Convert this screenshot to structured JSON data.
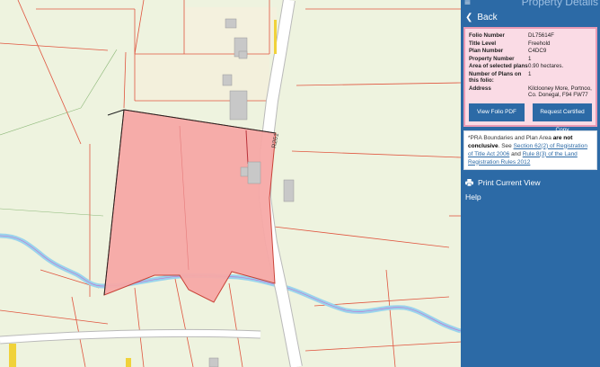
{
  "panel": {
    "title": "Property Details",
    "back_label": "Back",
    "folio": {
      "rows": [
        {
          "label": "Folio Number",
          "value": "DL75614F"
        },
        {
          "label": "Title Level",
          "value": "Freehold"
        },
        {
          "label": "Plan Number",
          "value": "C4DC9"
        },
        {
          "label": "Property Number",
          "value": "1"
        },
        {
          "label": "Area of selected plans",
          "value": "0.90 hectares."
        },
        {
          "label": "Number of Plans on this folio:",
          "value": "1"
        },
        {
          "label": "Address",
          "value": "Kilclooney More, Portnoo, Co. Donegal, F94 FW77"
        }
      ],
      "view_pdf_label": "View Folio PDF",
      "certified_copy_label": "Request Certified Copy"
    },
    "note": {
      "prefix": "*PRA Boundaries and Plan Area ",
      "bold": "are not conclusive",
      "mid1": ". See ",
      "link1": "Section 62(2) of Registration of Title Act 2006",
      "mid2": " and ",
      "link2": "Rule 8(3) of the Land Registration Rules 2012"
    },
    "print_label": "Print Current View",
    "help_label": "Help"
  },
  "map": {
    "road_label": "R261",
    "colors": {
      "background": "#eef3df",
      "boundary": "#e0553f",
      "parcel_fill": "#f7a9a7",
      "parcel_stroke": "#c8392f",
      "river": "#9ad3ec",
      "building": "#c8c8c8",
      "road_fill": "#ffffff",
      "road_edge": "#b9b9b9",
      "hint_yellow": "#f0d23a"
    }
  }
}
